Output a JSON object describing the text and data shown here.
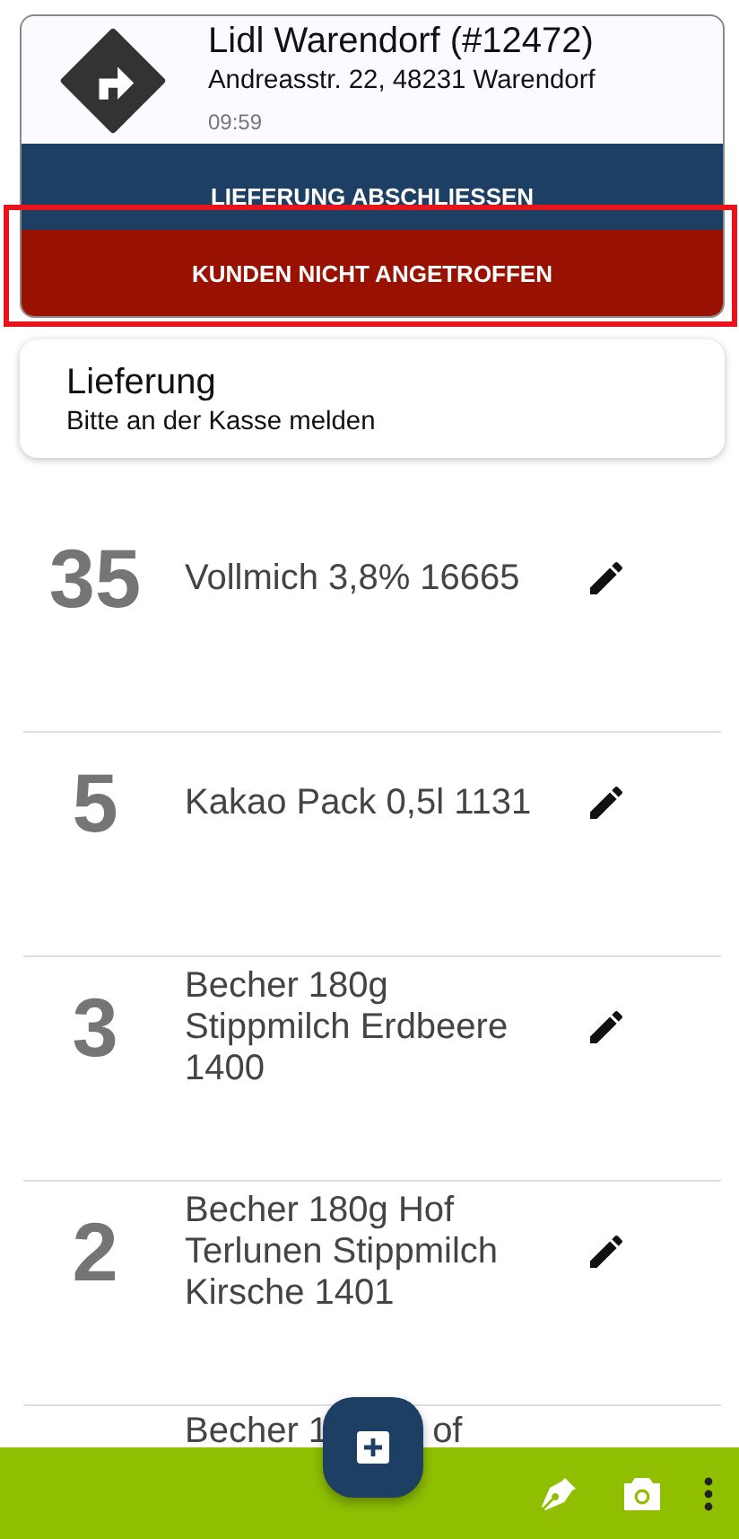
{
  "stop": {
    "title": "Lidl Warendorf (#12472)",
    "address": "Andreasstr. 22, 48231 Warendorf",
    "time": "09:59"
  },
  "actions": [
    {
      "label": "LIEFERUNG ABSCHLIESSEN",
      "kind": "complete",
      "highlighted": false
    },
    {
      "label": "KUNDEN NICHT ANGETROFFEN",
      "kind": "absent",
      "highlighted": true
    }
  ],
  "note": {
    "title": "Lieferung",
    "text": "Bitte an der Kasse melden"
  },
  "items": [
    {
      "quantity": "35",
      "name": "Vollmich 3,8% 16665"
    },
    {
      "quantity": "5",
      "name": "Kakao Pack 0,5l 1131"
    },
    {
      "quantity": "3",
      "name": "Becher 180g Stippmilch Erdbeere 1400"
    },
    {
      "quantity": "2",
      "name": "Becher 180g Hof Terlunen Stippmilch Kirsche 1401"
    },
    {
      "name_parts": [
        "Becher 1",
        "of"
      ]
    }
  ]
}
